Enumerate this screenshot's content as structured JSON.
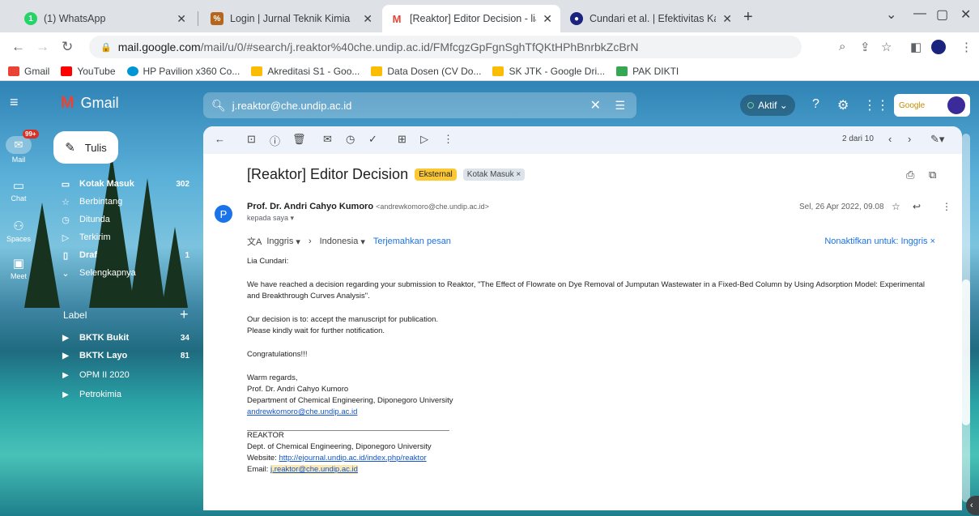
{
  "browser": {
    "tabs": [
      {
        "title": "(1) WhatsApp",
        "favicon": "whatsapp-icon",
        "color": "#25d366",
        "badge": "1"
      },
      {
        "title": "Login | Jurnal Teknik Kimia",
        "favicon": "journal-icon",
        "color": "#b5651d",
        "badge": "%"
      },
      {
        "title": "[Reaktor] Editor Decision - liacun",
        "favicon": "gmail-icon",
        "color": "#ea4335",
        "badge": "M"
      },
      {
        "title": "Cundari et al. | Efektivitas Karbon",
        "favicon": "journal-icon",
        "color": "#1a237e",
        "badge": "●"
      }
    ],
    "url_host": "mail.google.com",
    "url_rest": "/mail/u/0/#search/j.reaktor%40che.undip.ac.id/FMfcgzGpFgnSghTfQKtHPhBnrbkZcBrN",
    "bookmarks": [
      {
        "label": "Gmail",
        "icon": "gmail-icon",
        "color": "#ea4335"
      },
      {
        "label": "YouTube",
        "icon": "youtube-icon",
        "color": "#ff0000"
      },
      {
        "label": "HP Pavilion x360 Co...",
        "icon": "hp-icon",
        "color": "#0096d6"
      },
      {
        "label": "Akreditasi S1 - Goo...",
        "icon": "drive-icon",
        "color": "#fbbc04"
      },
      {
        "label": "Data Dosen (CV Do...",
        "icon": "drive-icon",
        "color": "#fbbc04"
      },
      {
        "label": "SK JTK - Google Dri...",
        "icon": "drive-icon",
        "color": "#fbbc04"
      },
      {
        "label": "PAK DIKTI",
        "icon": "bookmark-icon",
        "color": "#34a853"
      }
    ]
  },
  "gmail": {
    "app_name": "Gmail",
    "search_value": "j.reaktor@che.undip.ac.id",
    "status_label": "Aktif",
    "rail": [
      {
        "label": "Mail"
      },
      {
        "label": "Chat"
      },
      {
        "label": "Spaces"
      },
      {
        "label": "Meet"
      }
    ],
    "rail_badge": "99+",
    "compose_label": "Tulis",
    "nav": [
      {
        "label": "Kotak Masuk",
        "count": "302",
        "icon": "inbox-icon"
      },
      {
        "label": "Berbintang",
        "count": "",
        "icon": "star-icon"
      },
      {
        "label": "Ditunda",
        "count": "",
        "icon": "clock-icon"
      },
      {
        "label": "Terkirim",
        "count": "",
        "icon": "send-icon"
      },
      {
        "label": "Draf",
        "count": "1",
        "icon": "draft-icon"
      },
      {
        "label": "Selengkapnya",
        "count": "",
        "icon": "chevron-down-icon"
      }
    ],
    "labels_title": "Label",
    "labels": [
      {
        "label": "BKTK Bukit",
        "count": "34",
        "bold": true
      },
      {
        "label": "BKTK Layo",
        "count": "81",
        "bold": true
      },
      {
        "label": "OPM II 2020",
        "count": "",
        "bold": false
      },
      {
        "label": "Petrokimia",
        "count": "",
        "bold": false
      }
    ],
    "account_label": "Google"
  },
  "message": {
    "pagination": "2 dari 10",
    "subject": "[Reaktor] Editor Decision",
    "chip_external": "Eksternal",
    "chip_inbox": "Kotak Masuk ×",
    "sender_name": "Prof. Dr. Andri Cahyo Kumoro",
    "sender_email": "<andrewkomoro@che.undip.ac.id>",
    "to_line": "kepada saya ▾",
    "date": "Sel, 26 Apr 2022, 09.08",
    "translate": {
      "from": "Inggris",
      "to": "Indonesia",
      "action": "Terjemahkan pesan",
      "disable": "Nonaktifkan untuk: Inggris"
    },
    "body": {
      "greeting": "Lia Cundari:",
      "p1_line1": "We have reached a decision regarding your submission to Reaktor, \"The Effect of Flowrate on Dye Removal of Jumputan Wastewater in a Fixed-Bed Column by Using Adsorption Model: Experimental",
      "p1_line2": "and Breakthrough Curves Analysis\".",
      "decision": "Our decision is to: accept the manuscript for publication.",
      "wait": "Please kindly wait for further notification.",
      "congrats": "Congratulations!!!",
      "regards": "Warm regards,",
      "sig_name": "Prof. Dr. Andri Cahyo Kumoro",
      "sig_dept": "Department of Chemical Engineering, Diponegoro University",
      "sig_email": "andrewkomoro@che.undip.ac.id",
      "footer_title": "REAKTOR",
      "footer_dept": "Dept. of Chemical Engineering, Diponegoro University",
      "footer_website_label": "Website:",
      "footer_website": "http://ejournal.undip.ac.id/index.php/reaktor",
      "footer_email_label": "Email:",
      "footer_email": "j.reaktor@che.undip.ac.id"
    }
  }
}
